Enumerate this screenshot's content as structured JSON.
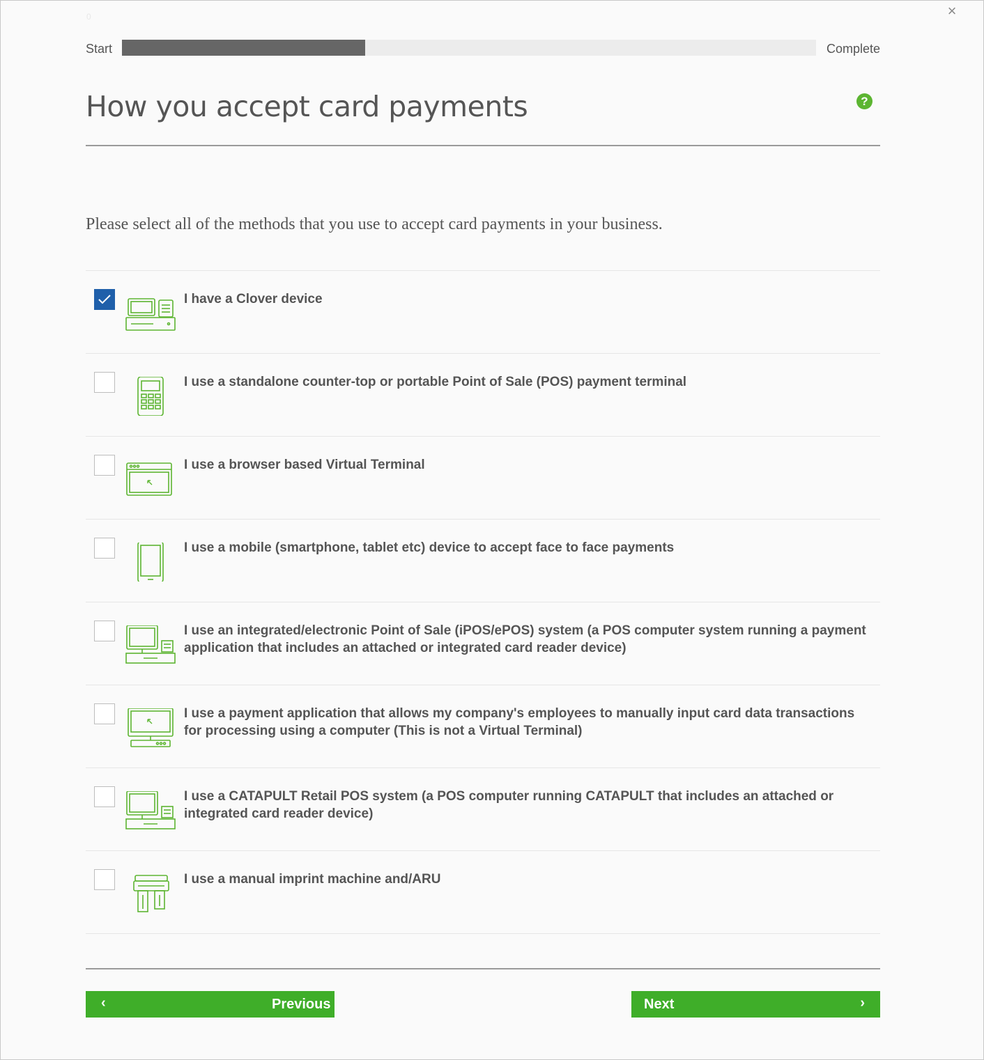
{
  "window": {
    "close_glyph": "×",
    "corner_mark": "0"
  },
  "progress": {
    "start_label": "Start",
    "complete_label": "Complete",
    "fraction": 0.35
  },
  "header": {
    "title": "How you accept card payments",
    "help_glyph": "?"
  },
  "instruction": "Please select all of the methods that you use to accept card payments in your business.",
  "options": [
    {
      "label": "I have a Clover device",
      "checked": true,
      "icon": "clover-register-icon"
    },
    {
      "label": "I use a standalone counter-top or portable Point of Sale (POS) payment terminal",
      "checked": false,
      "icon": "pos-terminal-icon"
    },
    {
      "label": "I use a browser based Virtual Terminal",
      "checked": false,
      "icon": "browser-window-icon"
    },
    {
      "label": "I use a mobile (smartphone, tablet etc) device to accept face to face payments",
      "checked": false,
      "icon": "mobile-device-icon"
    },
    {
      "label": "I use an integrated/electronic Point of Sale (iPOS/ePOS) system (a POS computer system running a payment application that includes an attached or integrated card reader device)",
      "checked": false,
      "icon": "pos-computer-icon"
    },
    {
      "label": "I use a payment application that allows my company's employees to manually input card data transactions for processing using a computer (This is not a Virtual Terminal)",
      "checked": false,
      "icon": "desktop-computer-icon"
    },
    {
      "label": "I use a CATAPULT Retail POS system (a POS computer running CATAPULT that includes an attached or integrated card reader device)",
      "checked": false,
      "icon": "pos-computer-icon"
    },
    {
      "label": "I use a manual imprint machine and/ARU",
      "checked": false,
      "icon": "imprint-machine-icon"
    }
  ],
  "nav": {
    "previous_label": "Previous",
    "next_label": "Next",
    "prev_chevron": "‹",
    "next_chevron": "›"
  },
  "colors": {
    "accent_green": "#3fae29",
    "icon_green": "#5cb531",
    "checkbox_blue": "#1f5faa",
    "progress_fill": "#666666"
  }
}
